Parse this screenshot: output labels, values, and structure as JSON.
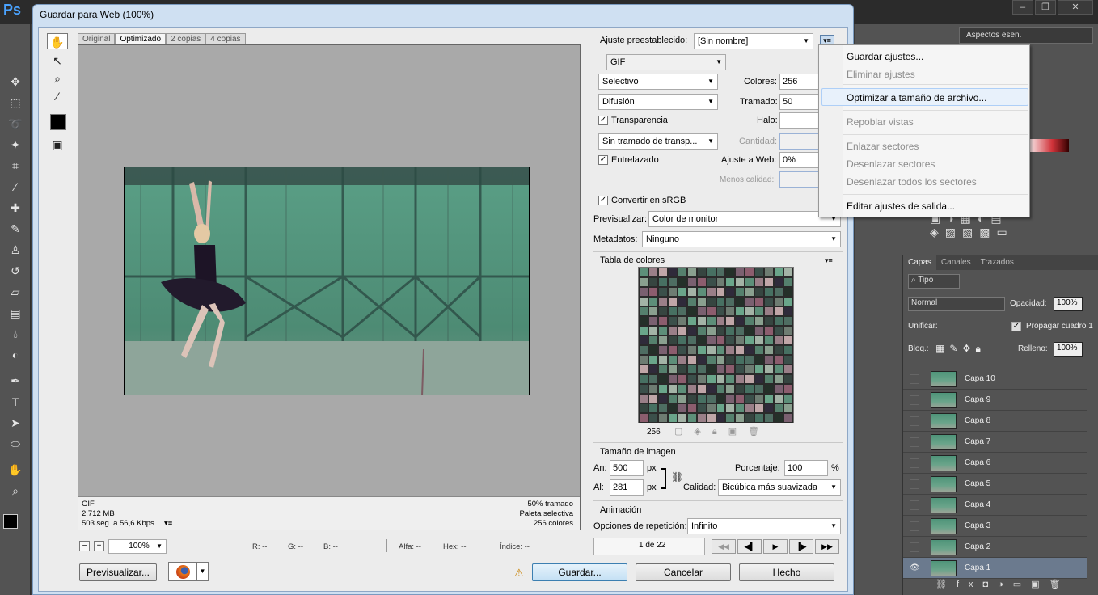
{
  "ps": {
    "logo": "Ps",
    "workspace": "Aspectos esen.",
    "layers": {
      "tabs": [
        "Capas",
        "Canales",
        "Trazados"
      ],
      "filter": "Tipo",
      "blend_mode": "Normal",
      "opacity_label": "Opacidad:",
      "opacity": "100%",
      "unify_label": "Unificar:",
      "propagate_label": "Propagar cuadro 1",
      "lock_label": "Bloq.:",
      "fill_label": "Relleno:",
      "fill": "100%",
      "items": [
        "Capa 10",
        "Capa 9",
        "Capa 8",
        "Capa 7",
        "Capa 6",
        "Capa 5",
        "Capa 4",
        "Capa 3",
        "Capa 2",
        "Capa 1"
      ]
    }
  },
  "dialog": {
    "title": "Guardar para Web (100%)",
    "tabs": [
      "Original",
      "Optimizado",
      "2 copias",
      "4 copias"
    ],
    "status": {
      "format": "GIF",
      "size": "2,712 MB",
      "time": "503 seg. a 56,6 Kbps",
      "dither": "50% tramado",
      "palette": "Paleta selectiva",
      "colors": "256 colores"
    },
    "bottom": {
      "zoom": "100%",
      "r": "R: --",
      "g": "G: --",
      "b": "B: --",
      "alpha": "Alfa: --",
      "hex": "Hex: --",
      "index": "Índice: --"
    },
    "buttons": {
      "preview": "Previsualizar...",
      "save": "Guardar...",
      "cancel": "Cancelar",
      "done": "Hecho"
    },
    "settings": {
      "preset_label": "Ajuste preestablecido:",
      "preset": "[Sin nombre]",
      "format": "GIF",
      "reduction": "Selectivo",
      "colors_label": "Colores:",
      "colors": "256",
      "dither_algo": "Difusión",
      "dither_label": "Tramado:",
      "dither": "50",
      "transparency": "Transparencia",
      "matte_label": "Halo:",
      "trans_dither": "Sin tramado de transp...",
      "amount_label": "Cantidad:",
      "interlaced": "Entrelazado",
      "websnap_label": "Ajuste a Web:",
      "websnap": "0%",
      "lossy_label": "Menos calidad:",
      "convert_srgb": "Convertir en sRGB",
      "preview_label": "Previsualizar:",
      "preview_value": "Color de monitor",
      "metadata_label": "Metadatos:",
      "metadata_value": "Ninguno",
      "color_table_title": "Tabla de colores",
      "color_count": "256",
      "image_size_title": "Tamaño de imagen",
      "width_label": "An:",
      "width": "500",
      "height_label": "Al:",
      "height": "281",
      "px": "px",
      "percent_label": "Porcentaje:",
      "percent": "100",
      "percent_sign": "%",
      "quality_label": "Calidad:",
      "quality": "Bicúbica más suavizada",
      "animation_title": "Animación",
      "loop_label": "Opciones de repetición:",
      "loop": "Infinito",
      "frame": "1 de 22"
    },
    "menu": {
      "items": [
        {
          "label": "Guardar ajustes...",
          "enabled": true
        },
        {
          "label": "Eliminar ajustes",
          "enabled": false
        },
        {
          "label": "Optimizar a tamaño de archivo...",
          "enabled": true
        },
        {
          "label": "Repoblar vistas",
          "enabled": false
        },
        {
          "label": "Enlazar sectores",
          "enabled": false
        },
        {
          "label": "Desenlazar sectores",
          "enabled": false
        },
        {
          "label": "Desenlazar todos los sectores",
          "enabled": false
        },
        {
          "label": "Editar ajustes de salida...",
          "enabled": true
        }
      ]
    }
  },
  "colors": {
    "ps_dark": "#535353",
    "dialog_chrome": "#cfe0f2",
    "selected_layer": "#6b7a8e",
    "menu_highlight": "#e8f1fb"
  }
}
